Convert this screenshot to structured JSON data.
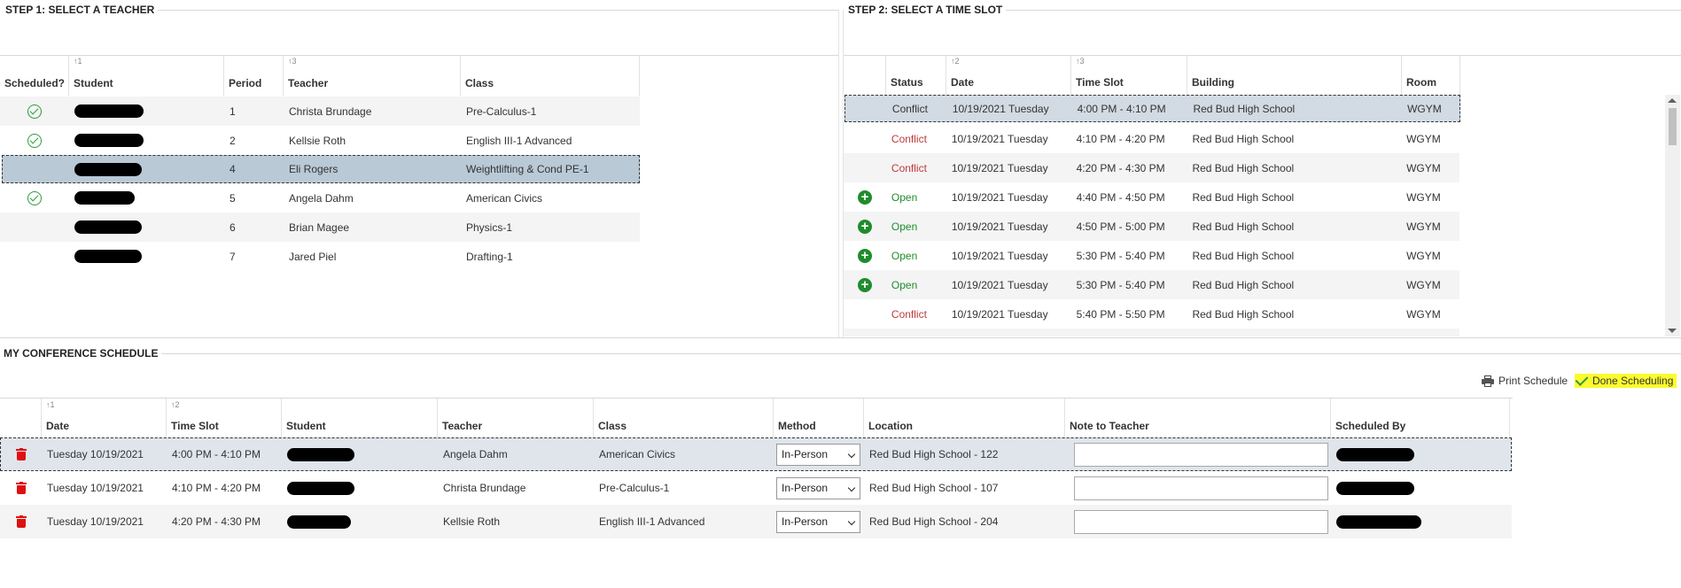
{
  "step1": {
    "title": "STEP 1: SELECT A TEACHER",
    "columns": [
      {
        "label": "Scheduled?",
        "sort": ""
      },
      {
        "label": "Student",
        "sort": "1"
      },
      {
        "label": "Period",
        "sort": ""
      },
      {
        "label": "Teacher",
        "sort": "3"
      },
      {
        "label": "Class",
        "sort": ""
      }
    ],
    "rows": [
      {
        "period": "1",
        "teacher": "Christa Brundage",
        "class": "Pre-Calculus-1"
      },
      {
        "period": "2",
        "teacher": "Kellsie Roth",
        "class": "English III-1 Advanced"
      },
      {
        "period": "4",
        "teacher": "Eli Rogers",
        "class": "Weightlifting & Cond PE-1"
      },
      {
        "period": "5",
        "teacher": "Angela Dahm",
        "class": "American Civics"
      },
      {
        "period": "6",
        "teacher": "Brian Magee",
        "class": "Physics-1"
      },
      {
        "period": "7",
        "teacher": "Jared Piel",
        "class": "Drafting-1"
      }
    ]
  },
  "step2": {
    "title": "STEP 2: SELECT A TIME SLOT",
    "columns": [
      {
        "label": "",
        "sort": ""
      },
      {
        "label": "Status",
        "sort": ""
      },
      {
        "label": "Date",
        "sort": "2"
      },
      {
        "label": "Time Slot",
        "sort": "3"
      },
      {
        "label": "Building",
        "sort": ""
      },
      {
        "label": "Room",
        "sort": ""
      }
    ],
    "rows": [
      {
        "status": "Conflict",
        "date": "10/19/2021 Tuesday",
        "time": "4:00 PM - 4:10 PM",
        "building": "Red Bud High School",
        "room": "WGYM"
      },
      {
        "status": "Conflict",
        "date": "10/19/2021 Tuesday",
        "time": "4:10 PM - 4:20 PM",
        "building": "Red Bud High School",
        "room": "WGYM"
      },
      {
        "status": "Conflict",
        "date": "10/19/2021 Tuesday",
        "time": "4:20 PM - 4:30 PM",
        "building": "Red Bud High School",
        "room": "WGYM"
      },
      {
        "status": "Open",
        "date": "10/19/2021 Tuesday",
        "time": "4:40 PM - 4:50 PM",
        "building": "Red Bud High School",
        "room": "WGYM"
      },
      {
        "status": "Open",
        "date": "10/19/2021 Tuesday",
        "time": "4:50 PM - 5:00 PM",
        "building": "Red Bud High School",
        "room": "WGYM"
      },
      {
        "status": "Open",
        "date": "10/19/2021 Tuesday",
        "time": "5:30 PM - 5:40 PM",
        "building": "Red Bud High School",
        "room": "WGYM"
      },
      {
        "status": "Open",
        "date": "10/19/2021 Tuesday",
        "time": "5:30 PM - 5:40 PM",
        "building": "Red Bud High School",
        "room": "WGYM"
      },
      {
        "status": "Conflict",
        "date": "10/19/2021 Tuesday",
        "time": "5:40 PM - 5:50 PM",
        "building": "Red Bud High School",
        "room": "WGYM"
      }
    ]
  },
  "schedule": {
    "title": "MY CONFERENCE SCHEDULE",
    "print_label": "Print Schedule",
    "done_label": "Done Scheduling",
    "columns": [
      {
        "label": "",
        "sort": ""
      },
      {
        "label": "Date",
        "sort": "1"
      },
      {
        "label": "Time Slot",
        "sort": "2"
      },
      {
        "label": "Student",
        "sort": ""
      },
      {
        "label": "Teacher",
        "sort": ""
      },
      {
        "label": "Class",
        "sort": ""
      },
      {
        "label": "Method",
        "sort": ""
      },
      {
        "label": "Location",
        "sort": ""
      },
      {
        "label": "Note to Teacher",
        "sort": ""
      },
      {
        "label": "Scheduled By",
        "sort": ""
      }
    ],
    "rows": [
      {
        "date": "Tuesday 10/19/2021",
        "time": "4:00 PM - 4:10 PM",
        "teacher": "Angela Dahm",
        "class": "American Civics",
        "method": "In-Person",
        "location": "Red Bud High School - 122",
        "note": ""
      },
      {
        "date": "Tuesday 10/19/2021",
        "time": "4:10 PM - 4:20 PM",
        "teacher": "Christa Brundage",
        "class": "Pre-Calculus-1",
        "method": "In-Person",
        "location": "Red Bud High School - 107",
        "note": ""
      },
      {
        "date": "Tuesday 10/19/2021",
        "time": "4:20 PM - 4:30 PM",
        "teacher": "Kellsie Roth",
        "class": "English III-1 Advanced",
        "method": "In-Person",
        "location": "Red Bud High School - 204",
        "note": ""
      }
    ]
  },
  "colors": {
    "selected_row": "#b9c9d6",
    "alt_row": "#f4f4f4",
    "conflict": "#c0393b",
    "open": "#1f8c2c",
    "highlight": "#fbfb2e"
  }
}
